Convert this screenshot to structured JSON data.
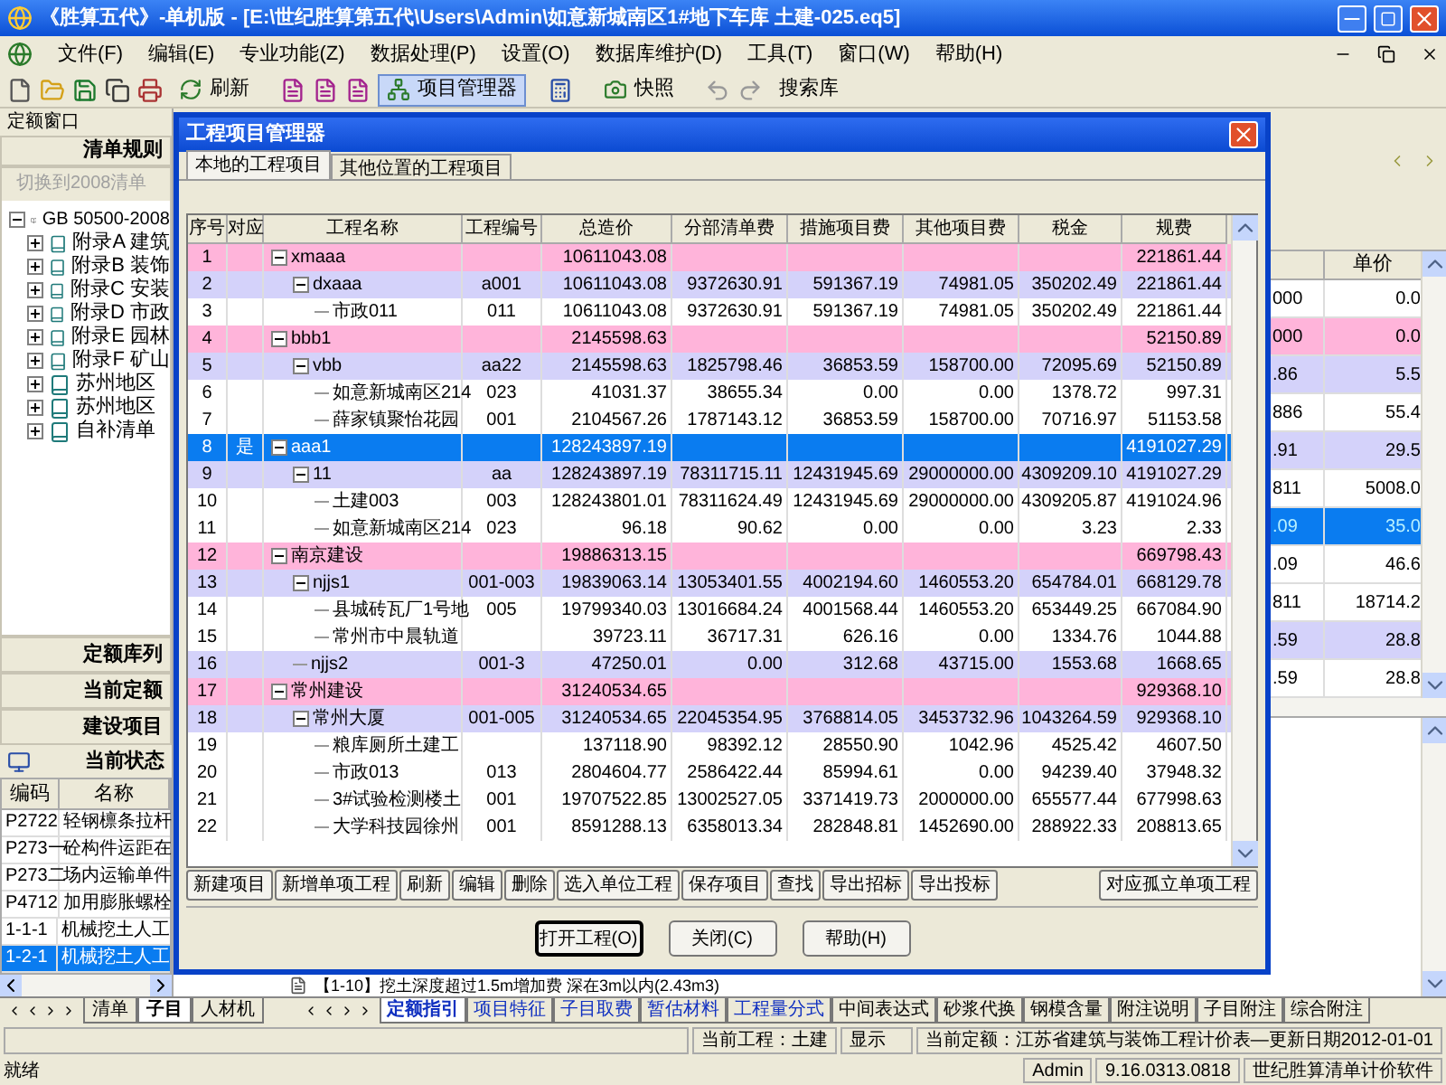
{
  "window": {
    "title": "《胜算五代》-单机版 - [E:\\世纪胜算第五代\\Users\\Admin\\如意新城南区1#地下车库 土建-025.eq5]"
  },
  "menu": [
    "文件(F)",
    "编辑(E)",
    "专业功能(Z)",
    "数据处理(P)",
    "设置(O)",
    "数据库维护(D)",
    "工具(T)",
    "窗口(W)",
    "帮助(H)"
  ],
  "toolbar": [
    {
      "label": "刷新",
      "selected": false
    },
    {
      "label": "项目管理器",
      "selected": true
    },
    {
      "label": "快照",
      "selected": false
    },
    {
      "label": "搜索库",
      "selected": false
    }
  ],
  "left_panel": {
    "window_label": "定额窗口",
    "header": "清单规则",
    "switch_link": "切换到2008清单",
    "tree": [
      {
        "label": "GB 50500-2008",
        "expanded": true,
        "children": [
          {
            "label": "附录A 建筑",
            "expanded": false
          },
          {
            "label": "附录B 装饰",
            "expanded": false
          },
          {
            "label": "附录C 安装",
            "expanded": false
          },
          {
            "label": "附录D 市政",
            "expanded": false
          },
          {
            "label": "附录E 园林",
            "expanded": false
          },
          {
            "label": "附录F 矿山",
            "expanded": false
          },
          {
            "label": "苏州地区",
            "expanded": false
          },
          {
            "label": "苏州地区",
            "expanded": false
          },
          {
            "label": "自补清单",
            "expanded": false
          }
        ]
      }
    ],
    "sections": [
      "定额库列",
      "当前定额",
      "建设项目"
    ],
    "status_title": "当前状态",
    "table": {
      "columns": [
        "编码",
        "名称"
      ],
      "rows": [
        {
          "code": "P2722",
          "name": "轻钢檩条拉杆",
          "selected": false
        },
        {
          "code": "P273一",
          "name": "砼构件运距在",
          "selected": false
        },
        {
          "code": "P273二",
          "name": "场内运输单件",
          "selected": false
        },
        {
          "code": "P4712",
          "name": "加用膨胀螺栓",
          "selected": false
        },
        {
          "code": "1-1-1",
          "name": "机械挖土人工",
          "selected": false
        },
        {
          "code": "1-2-1",
          "name": "机械挖土人工",
          "selected": true
        }
      ]
    },
    "bottom_tabs": [
      {
        "label": "清单",
        "selected": false
      },
      {
        "label": "子目",
        "selected": true
      },
      {
        "label": "人材机",
        "selected": false
      }
    ]
  },
  "dialog": {
    "title": "工程项目管理器",
    "tabs": [
      {
        "label": "本地的工程项目",
        "selected": true
      },
      {
        "label": "其他位置的工程项目",
        "selected": false
      }
    ],
    "columns": [
      "序号",
      "对应",
      "工程名称",
      "工程编号",
      "总造价",
      "分部清单费",
      "措施项目费",
      "其他项目费",
      "税金",
      "规费"
    ],
    "projects": [
      {
        "no": "1",
        "name": "xmaaa",
        "total": "10611043.08",
        "fees": "221861.44",
        "selected": false,
        "expanded": true,
        "children": [
          {
            "no": "2",
            "name": "dxaaa",
            "code": "a001",
            "total": "10611043.08",
            "items": "9372630.91",
            "measures": "591367.19",
            "other": "74981.05",
            "tax": "350202.49",
            "fees": "221861.44",
            "selected": false,
            "expanded": true,
            "children": [
              {
                "no": "3",
                "name": "市政011",
                "code": "011",
                "total": "10611043.08",
                "items": "9372630.91",
                "measures": "591367.19",
                "other": "74981.05",
                "tax": "350202.49",
                "fees": "221861.44",
                "selected": false
              }
            ]
          }
        ]
      },
      {
        "no": "4",
        "name": "bbb1",
        "total": "2145598.63",
        "fees": "52150.89",
        "selected": false,
        "expanded": true,
        "children": [
          {
            "no": "5",
            "name": "vbb",
            "code": "aa22",
            "total": "2145598.63",
            "items": "1825798.46",
            "measures": "36853.59",
            "other": "158700.00",
            "tax": "72095.69",
            "fees": "52150.89",
            "selected": false,
            "expanded": true,
            "children": [
              {
                "no": "6",
                "name": "如意新城南区214",
                "code": "023",
                "total": "41031.37",
                "items": "38655.34",
                "measures": "0.00",
                "other": "0.00",
                "tax": "1378.72",
                "fees": "997.31",
                "selected": false
              },
              {
                "no": "7",
                "name": "薛家镇聚怡花园",
                "code": "001",
                "total": "2104567.26",
                "items": "1787143.12",
                "measures": "36853.59",
                "other": "158700.00",
                "tax": "70716.97",
                "fees": "51153.58",
                "selected": false
              }
            ]
          }
        ]
      },
      {
        "no": "8",
        "match": "是",
        "name": "aaa1",
        "total": "128243897.19",
        "fees": "4191027.29",
        "selected": true,
        "expanded": true,
        "children": [
          {
            "no": "9",
            "name": "11",
            "code": "aa",
            "total": "128243897.19",
            "items": "78311715.11",
            "measures": "12431945.69",
            "other": "29000000.00",
            "tax": "4309209.10",
            "fees": "4191027.29",
            "selected": false,
            "expanded": true,
            "children": [
              {
                "no": "10",
                "name": "土建003",
                "code": "003",
                "total": "128243801.01",
                "items": "78311624.49",
                "measures": "12431945.69",
                "other": "29000000.00",
                "tax": "4309205.87",
                "fees": "4191024.96",
                "selected": false
              },
              {
                "no": "11",
                "name": "如意新城南区214",
                "code": "023",
                "total": "96.18",
                "items": "90.62",
                "measures": "0.00",
                "other": "0.00",
                "tax": "3.23",
                "fees": "2.33",
                "selected": false
              }
            ]
          }
        ]
      },
      {
        "no": "12",
        "name": "南京建设",
        "total": "19886313.15",
        "fees": "669798.43",
        "selected": false,
        "expanded": true,
        "children": [
          {
            "no": "13",
            "name": "njjs1",
            "code": "001-003",
            "total": "19839063.14",
            "items": "13053401.55",
            "measures": "4002194.60",
            "other": "1460553.20",
            "tax": "654784.01",
            "fees": "668129.78",
            "selected": false,
            "expanded": true,
            "children": [
              {
                "no": "14",
                "name": "县城砖瓦厂1号地",
                "code": "005",
                "total": "19799340.03",
                "items": "13016684.24",
                "measures": "4001568.44",
                "other": "1460553.20",
                "tax": "653449.25",
                "fees": "667084.90",
                "selected": false
              },
              {
                "no": "15",
                "name": "常州市中晨轨道",
                "total": "39723.11",
                "items": "36717.31",
                "measures": "626.16",
                "other": "0.00",
                "tax": "1334.76",
                "fees": "1044.88",
                "selected": false
              }
            ]
          },
          {
            "no": "16",
            "name": "njjs2",
            "code": "001-3",
            "total": "47250.01",
            "items": "0.00",
            "measures": "312.68",
            "other": "43715.00",
            "tax": "1553.68",
            "fees": "1668.65",
            "selected": false
          }
        ]
      },
      {
        "no": "17",
        "name": "常州建设",
        "total": "31240534.65",
        "fees": "929368.10",
        "selected": false,
        "expanded": true,
        "children": [
          {
            "no": "18",
            "name": "常州大厦",
            "code": "001-005",
            "total": "31240534.65",
            "items": "22045354.95",
            "measures": "3768814.05",
            "other": "3453732.96",
            "tax": "1043264.59",
            "fees": "929368.10",
            "selected": false,
            "expanded": true,
            "children": [
              {
                "no": "19",
                "name": "粮库厕所土建工",
                "total": "137118.90",
                "items": "98392.12",
                "measures": "28550.90",
                "other": "1042.96",
                "tax": "4525.42",
                "fees": "4607.50",
                "selected": false
              },
              {
                "no": "20",
                "name": "市政013",
                "code": "013",
                "total": "2804604.77",
                "items": "2586422.44",
                "measures": "85994.61",
                "other": "0.00",
                "tax": "94239.40",
                "fees": "37948.32",
                "selected": false
              },
              {
                "no": "21",
                "name": "3#试验检测楼土",
                "code": "001",
                "total": "19707522.85",
                "items": "13002527.05",
                "measures": "3371419.73",
                "other": "2000000.00",
                "tax": "655577.44",
                "fees": "677998.63",
                "selected": false
              },
              {
                "no": "22",
                "name": "大学科技园徐州",
                "code": "001",
                "total": "8591288.13",
                "items": "6358013.34",
                "measures": "282848.81",
                "other": "1452690.00",
                "tax": "288922.33",
                "fees": "208813.65",
                "selected": false
              }
            ]
          }
        ]
      }
    ],
    "actions": [
      "新建项目",
      "新增单项工程",
      "刷新",
      "编辑",
      "删除",
      "选入单位工程",
      "保存项目",
      "查找",
      "导出招标",
      "导出投标"
    ],
    "extra_action": "对应孤立单项工程",
    "footer_buttons": [
      "打开工程(O)",
      "关闭(C)",
      "帮助(H)"
    ]
  },
  "right_panel": {
    "columns": [
      "单价"
    ],
    "rows": [
      {
        "column_1": "000",
        "unit_price": "0.0",
        "kind": "plain",
        "selected": false
      },
      {
        "column_1": "000",
        "unit_price": "0.0",
        "kind": "pink",
        "selected": false
      },
      {
        "column_1": ".86",
        "unit_price": "5.5",
        "kind": "lavender",
        "selected": false
      },
      {
        "column_1": "886",
        "unit_price": "55.4",
        "kind": "plain",
        "selected": false
      },
      {
        "column_1": ".91",
        "unit_price": "29.5",
        "kind": "lavender",
        "selected": false
      },
      {
        "column_1": "811",
        "unit_price": "5008.0",
        "kind": "plain",
        "selected": false
      },
      {
        "column_1": ".09",
        "unit_price": "35.0",
        "selected": true
      },
      {
        "column_1": ".09",
        "unit_price": "46.6",
        "kind": "plain",
        "selected": false
      },
      {
        "column_1": "811",
        "unit_price": "18714.2",
        "kind": "plain",
        "selected": false
      },
      {
        "column_1": ".59",
        "unit_price": "28.8",
        "kind": "lavender",
        "selected": false
      },
      {
        "column_1": ".59",
        "unit_price": "28.8",
        "kind": "plain",
        "selected": false
      }
    ]
  },
  "guide_line": "【1-10】挖土深度超过1.5m增加费 深在3m以内(2.43m3)",
  "detail_tabs": [
    {
      "label": "定额指引",
      "selected": true,
      "highlighted": true
    },
    {
      "label": "项目特征",
      "selected": false,
      "highlighted": true
    },
    {
      "label": "子目取费",
      "selected": false,
      "highlighted": true
    },
    {
      "label": "暂估材料",
      "selected": false,
      "highlighted": true
    },
    {
      "label": "工程量分式",
      "selected": false,
      "highlighted": true
    },
    {
      "label": "中间表达式",
      "selected": false,
      "highlighted": false
    },
    {
      "label": "砂浆代换",
      "selected": false,
      "highlighted": false
    },
    {
      "label": "钢模含量",
      "selected": false,
      "highlighted": false
    },
    {
      "label": "附注说明",
      "selected": false,
      "highlighted": false
    },
    {
      "label": "子目附注",
      "selected": false,
      "highlighted": false
    },
    {
      "label": "综合附注",
      "selected": false,
      "highlighted": false
    }
  ],
  "status_bar": {
    "project": "当前工程：土建",
    "display": "显示",
    "quota": "当前定额：江苏省建筑与装饰工程计价表—更新日期2012-01-01"
  },
  "status_bar_2": {
    "message": "就绪",
    "user": "Admin",
    "version": "9.16.0313.0818",
    "product": "世纪胜算清单计价软件"
  }
}
